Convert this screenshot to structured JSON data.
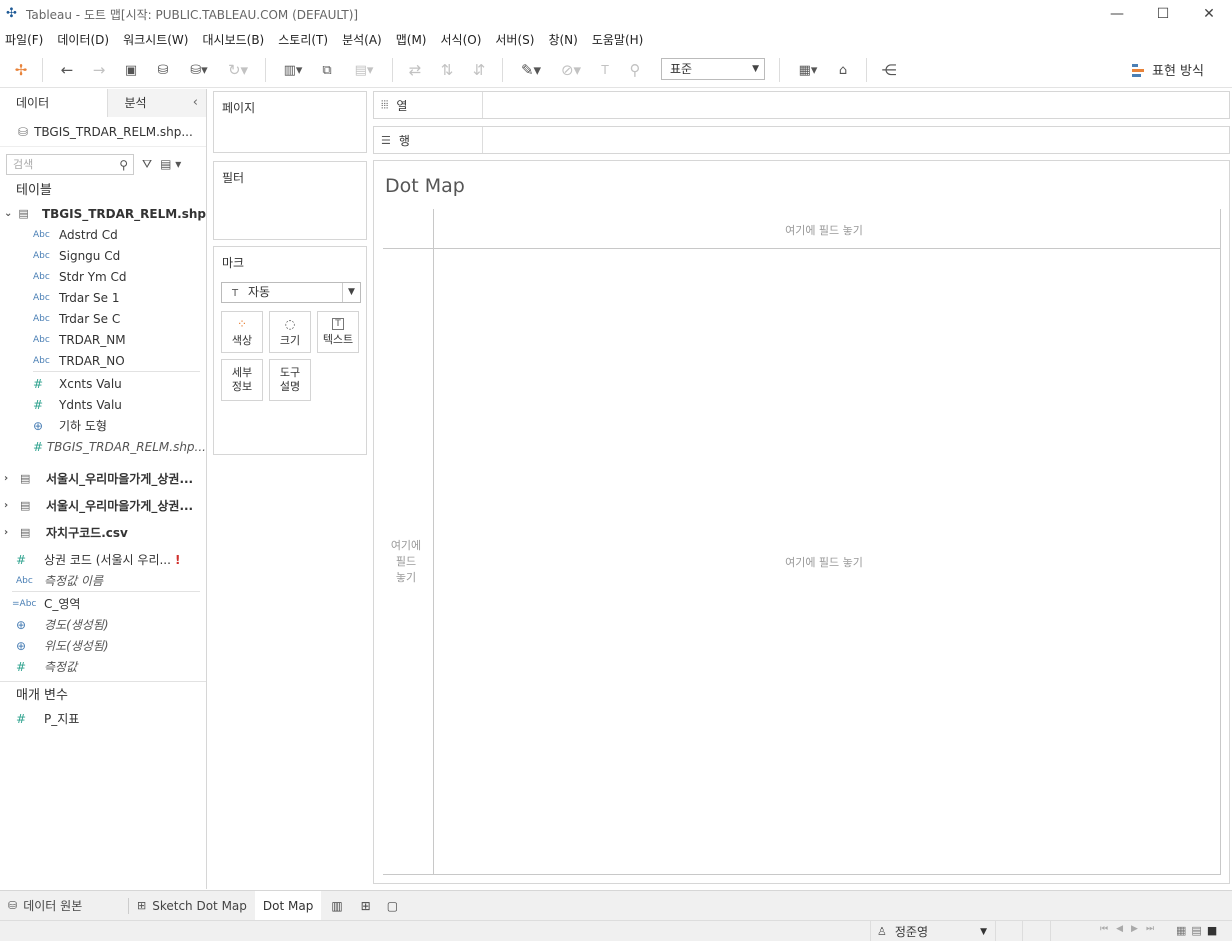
{
  "window": {
    "title": "Tableau - 도트 맵[시작: PUBLIC.TABLEAU.COM (DEFAULT)]",
    "minimize": "—",
    "maximize": "☐",
    "close": "✕"
  },
  "menu": [
    "파일(F)",
    "데이터(D)",
    "워크시트(W)",
    "대시보드(B)",
    "스토리(T)",
    "분석(A)",
    "맵(M)",
    "서식(O)",
    "서버(S)",
    "창(N)",
    "도움말(H)"
  ],
  "toolbar": {
    "fit_select": "표준",
    "show_me": "표현 방식"
  },
  "left": {
    "tab_data": "데이터",
    "tab_analysis": "분석",
    "datasource": "TBGIS_TRDAR_RELM.shp...",
    "search_placeholder": "검색",
    "tables_title": "테이블",
    "main_table": "TBGIS_TRDAR_RELM.shp",
    "dim_fields": [
      "Adstrd Cd",
      "Signgu Cd",
      "Stdr Ym Cd",
      "Trdar Se 1",
      "Trdar Se C",
      "TRDAR_NM",
      "TRDAR_NO"
    ],
    "measure_fields": [
      "Xcnts Valu",
      "Ydnts Valu"
    ],
    "geo_field": "기하 도형",
    "count_field": "TBGIS_TRDAR_RELM.shp...",
    "other_tables": [
      "서울시_우리마을가게_상권...",
      "서울시_우리마을가게_상권...",
      "자치구코드.csv"
    ],
    "loose_fields": {
      "code": "상권 코드 (서울시 우리...",
      "code_warn": "!",
      "measure_names": "측정값 이름",
      "c_area": "C_영역",
      "lon": "경도(생성됨)",
      "lat": "위도(생성됨)",
      "measure_values": "측정값"
    },
    "params_title": "매개 변수",
    "param": "P_지표"
  },
  "cards": {
    "pages": "페이지",
    "filters": "필터",
    "marks": "마크",
    "marks_type": "자동",
    "color": "색상",
    "size": "크기",
    "text": "텍스트",
    "detail_1": "세부",
    "detail_2": "정보",
    "tooltip_1": "도구",
    "tooltip_2": "설명"
  },
  "shelves": {
    "columns": "열",
    "rows": "행"
  },
  "view": {
    "title": "Dot Map",
    "drop_top": "여기에 필드 놓기",
    "drop_left_1": "여기에",
    "drop_left_2": "필드",
    "drop_left_3": "놓기",
    "drop_center": "여기에 필드 놓기"
  },
  "sheets": {
    "datasource": "데이터 원본",
    "sketch": "Sketch Dot Map",
    "dotmap": "Dot Map"
  },
  "status": {
    "user": "정준영"
  },
  "colors": {
    "accent_blue": "#4a7fb5",
    "measure_green": "#2ea28e",
    "warn_red": "#d0312d"
  }
}
